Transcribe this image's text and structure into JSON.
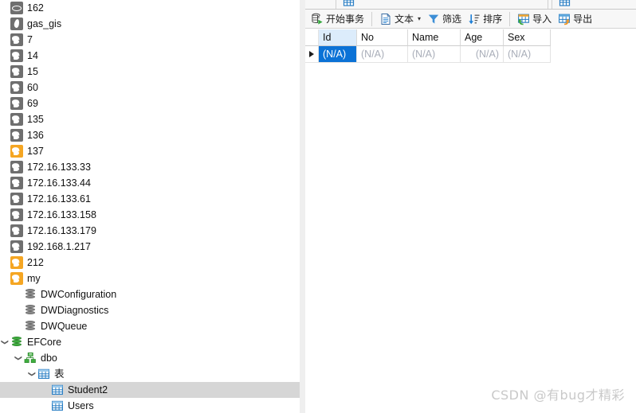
{
  "left_tree": {
    "items": [
      {
        "label": "162",
        "icon": "oval-db-icon",
        "indent": 1,
        "twisty": "",
        "selected": false
      },
      {
        "label": "gas_gis",
        "icon": "feather-icon",
        "indent": 1,
        "twisty": "",
        "selected": false
      },
      {
        "label": "7",
        "icon": "mysql-icon",
        "indent": 1,
        "twisty": "",
        "selected": false
      },
      {
        "label": "14",
        "icon": "mysql-icon",
        "indent": 1,
        "twisty": "",
        "selected": false
      },
      {
        "label": "15",
        "icon": "mysql-icon",
        "indent": 1,
        "twisty": "",
        "selected": false
      },
      {
        "label": "60",
        "icon": "mysql-icon",
        "indent": 1,
        "twisty": "",
        "selected": false
      },
      {
        "label": "69",
        "icon": "mysql-icon",
        "indent": 1,
        "twisty": "",
        "selected": false
      },
      {
        "label": "135",
        "icon": "mysql-icon",
        "indent": 1,
        "twisty": "",
        "selected": false
      },
      {
        "label": "136",
        "icon": "mysql-icon",
        "indent": 1,
        "twisty": "",
        "selected": false
      },
      {
        "label": "137",
        "icon": "mysql-icon-active",
        "indent": 1,
        "twisty": "",
        "selected": false
      },
      {
        "label": "172.16.133.33",
        "icon": "mysql-icon",
        "indent": 1,
        "twisty": "",
        "selected": false
      },
      {
        "label": "172.16.133.44",
        "icon": "mysql-icon",
        "indent": 1,
        "twisty": "",
        "selected": false
      },
      {
        "label": "172.16.133.61",
        "icon": "mysql-icon",
        "indent": 1,
        "twisty": "",
        "selected": false
      },
      {
        "label": "172.16.133.158",
        "icon": "mysql-icon",
        "indent": 1,
        "twisty": "",
        "selected": false
      },
      {
        "label": "172.16.133.179",
        "icon": "mysql-icon",
        "indent": 1,
        "twisty": "",
        "selected": false
      },
      {
        "label": "192.168.1.217",
        "icon": "mysql-icon",
        "indent": 1,
        "twisty": "",
        "selected": false
      },
      {
        "label": "212",
        "icon": "mysql-icon-active",
        "indent": 1,
        "twisty": "",
        "selected": false
      },
      {
        "label": "my",
        "icon": "mysql-icon-active",
        "indent": 1,
        "twisty": "",
        "selected": false
      },
      {
        "label": "DWConfiguration",
        "icon": "database-icon",
        "indent": 2,
        "twisty": "",
        "selected": false
      },
      {
        "label": "DWDiagnostics",
        "icon": "database-icon",
        "indent": 2,
        "twisty": "",
        "selected": false
      },
      {
        "label": "DWQueue",
        "icon": "database-icon",
        "indent": 2,
        "twisty": "",
        "selected": false
      },
      {
        "label": "EFCore",
        "icon": "database-icon-open",
        "indent": 1,
        "twisty": "v",
        "selected": false
      },
      {
        "label": "dbo",
        "icon": "schema-icon",
        "indent": 2,
        "twisty": "v",
        "selected": false
      },
      {
        "label": "表",
        "icon": "table-folder-icon",
        "indent": 3,
        "twisty": "v",
        "selected": false
      },
      {
        "label": "Student2",
        "icon": "table-icon",
        "indent": 4,
        "twisty": "",
        "selected": true
      },
      {
        "label": "Users",
        "icon": "table-icon",
        "indent": 4,
        "twisty": "",
        "selected": false
      }
    ]
  },
  "toolbar": {
    "begin_transaction": "开始事务",
    "text": "文本",
    "text_caret": "▾",
    "filter": "筛选",
    "sort": "排序",
    "import": "导入",
    "export": "导出"
  },
  "grid": {
    "columns": [
      {
        "label": "Id",
        "width": 48,
        "align": "left",
        "highlight": true
      },
      {
        "label": "No",
        "width": 64,
        "align": "left",
        "highlight": false
      },
      {
        "label": "Name",
        "width": 66,
        "align": "left",
        "highlight": false
      },
      {
        "label": "Age",
        "width": 54,
        "align": "right",
        "highlight": false
      },
      {
        "label": "Sex",
        "width": 59,
        "align": "left",
        "highlight": false
      }
    ],
    "rows": [
      {
        "current": true,
        "cells": [
          {
            "value": "(N/A)",
            "selected": true
          },
          {
            "value": "(N/A)",
            "selected": false
          },
          {
            "value": "(N/A)",
            "selected": false
          },
          {
            "value": "(N/A)",
            "selected": false
          },
          {
            "value": "(N/A)",
            "selected": false
          }
        ]
      }
    ]
  },
  "watermark": "CSDN @有bug才精彩",
  "colors": {
    "selection_blue": "#0b72d6",
    "header_highlight": "#dcecfb",
    "tree_selection": "#d6d6d6",
    "mysql_active": "#f5a623",
    "mysql_inactive": "#6f6f6f",
    "db_green": "#3fae3f",
    "grid_blue": "#2b7fc4",
    "null_text": "#a8adb8"
  }
}
